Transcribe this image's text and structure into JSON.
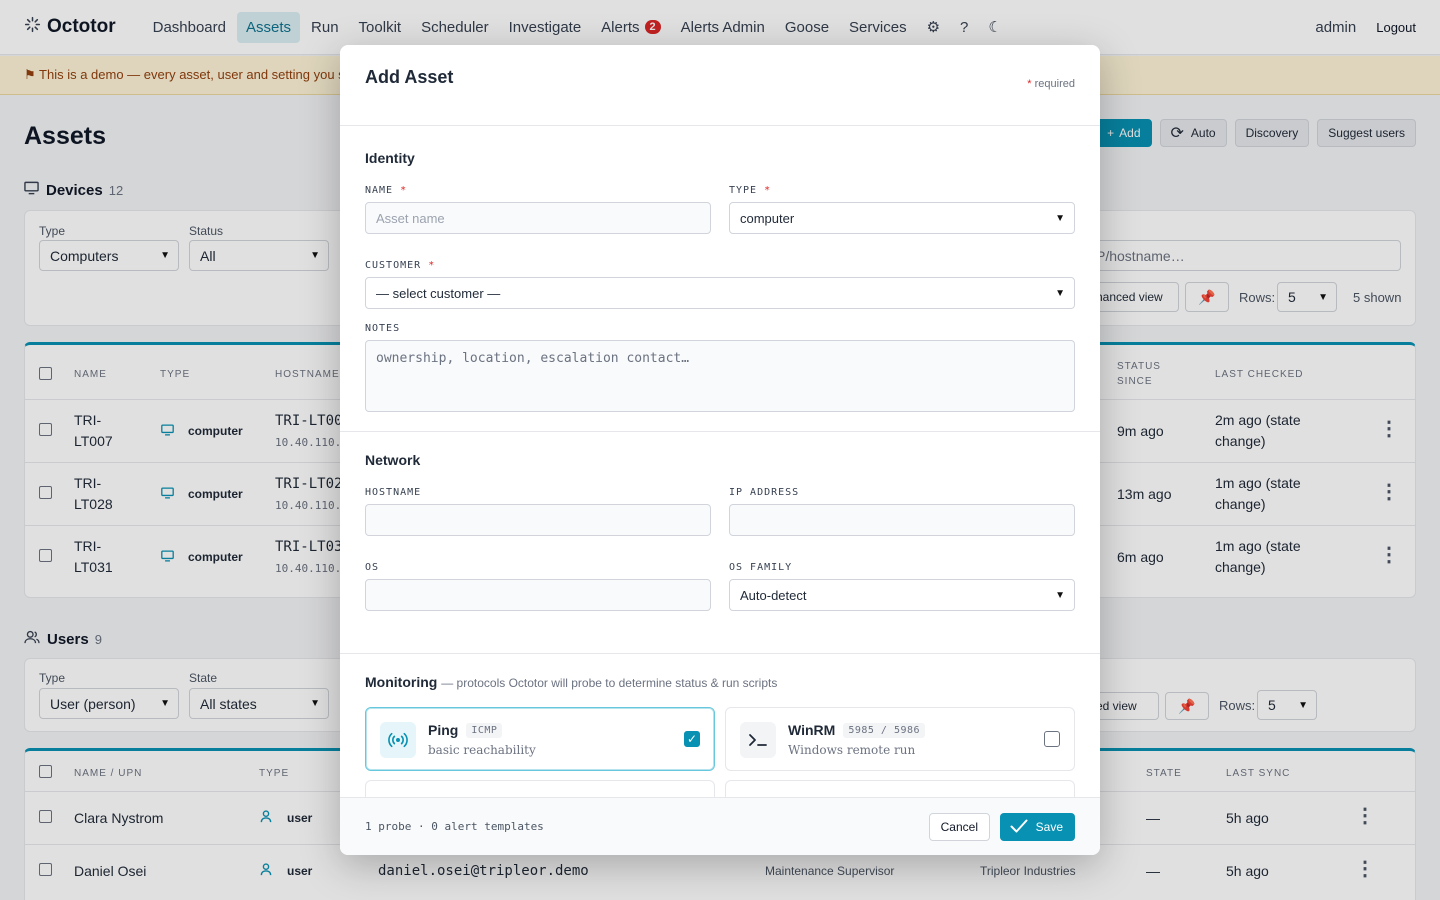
{
  "nav": {
    "brand": "Octotor",
    "items": [
      "Dashboard",
      "Assets",
      "Run",
      "Toolkit",
      "Scheduler",
      "Investigate",
      "Alerts",
      "Alerts Admin",
      "Goose",
      "Services"
    ],
    "alerts_badge": "2",
    "user": "admin",
    "logout": "Logout"
  },
  "banner": {
    "text": "⚑ This is a demo — every asset, user and setting you s"
  },
  "page": {
    "title": "Assets",
    "toolbar": {
      "add": "Add",
      "auto": "Auto",
      "discovery": "Discovery",
      "suggest": "Suggest users"
    }
  },
  "devices": {
    "title": "Devices",
    "count": "12",
    "filters": {
      "type_label": "Type",
      "type_value": "Computers",
      "status_label": "Status",
      "status_value": "All",
      "search_placeholder": "P/hostname…",
      "advanced": "hanced view",
      "rows_label": "Rows:",
      "rows_value": "5",
      "shown": "5 shown"
    },
    "headers": {
      "name": "NAME",
      "type": "TYPE",
      "hostname": "HOSTNAME /",
      "status_since_1": "STATUS",
      "status_since_2": "SINCE",
      "last_checked": "LAST CHECKED"
    },
    "rows": [
      {
        "name1": "TRI-",
        "name2": "LT007",
        "type": "computer",
        "hostname": "TRI-LT00",
        "ip": "10.40.110.",
        "since": "9m ago",
        "checked1": "2m ago (state",
        "checked2": "change)"
      },
      {
        "name1": "TRI-",
        "name2": "LT028",
        "type": "computer",
        "hostname": "TRI-LT02",
        "ip": "10.40.110.",
        "since": "13m ago",
        "checked1": "1m ago (state",
        "checked2": "change)"
      },
      {
        "name1": "TRI-",
        "name2": "LT031",
        "type": "computer",
        "hostname": "TRI-LT03",
        "ip": "10.40.110.",
        "since": "6m ago",
        "checked1": "1m ago (state",
        "checked2": "change)"
      }
    ]
  },
  "users": {
    "title": "Users",
    "count": "9",
    "filters": {
      "type_label": "Type",
      "type_value": "User (person)",
      "state_label": "State",
      "state_value": "All states",
      "advanced": "ed view",
      "rows_label": "Rows:",
      "rows_value": "5"
    },
    "headers": {
      "name": "NAME / UPN",
      "type": "TYPE",
      "state": "STATE",
      "last_sync": "LAST SYNC"
    },
    "rows": [
      {
        "name": "Clara Nystrom",
        "type": "user",
        "upn": "",
        "title": "",
        "company": "",
        "state": "—",
        "sync": "5h ago"
      },
      {
        "name": "Daniel Osei",
        "type": "user",
        "upn": "daniel.osei@tripleor.demo",
        "title": "Maintenance Supervisor",
        "company": "Tripleor Industries",
        "state": "—",
        "sync": "5h ago"
      }
    ]
  },
  "modal": {
    "title": "Add Asset",
    "required_star": "*",
    "required_note": "required",
    "identity": {
      "heading": "Identity",
      "name_label": "NAME",
      "name_placeholder": "Asset name",
      "type_label": "TYPE",
      "type_value": "computer",
      "customer_label": "CUSTOMER",
      "customer_value": "— select customer —",
      "notes_label": "NOTES",
      "notes_placeholder": "ownership, location, escalation contact…"
    },
    "network": {
      "heading": "Network",
      "hostname_label": "HOSTNAME",
      "ip_label": "IP ADDRESS",
      "os_label": "OS",
      "os_family_label": "OS FAMILY",
      "os_family_value": "Auto-detect"
    },
    "monitoring": {
      "heading": "Monitoring",
      "sub": "— protocols Octotor will probe to determine status & run scripts",
      "probes": [
        {
          "name": "Ping",
          "tag": "ICMP",
          "desc": "basic reachability",
          "checked": true
        },
        {
          "name": "WinRM",
          "tag": "5985 / 5986",
          "desc": "Windows remote run",
          "checked": false
        }
      ]
    },
    "footer": {
      "summary": "1 probe · 0 alert templates",
      "cancel": "Cancel",
      "save": "Save"
    }
  },
  "colors": {
    "accent": "#0891b2",
    "danger": "#dc2626",
    "banner_bg": "#fdf3d7"
  }
}
